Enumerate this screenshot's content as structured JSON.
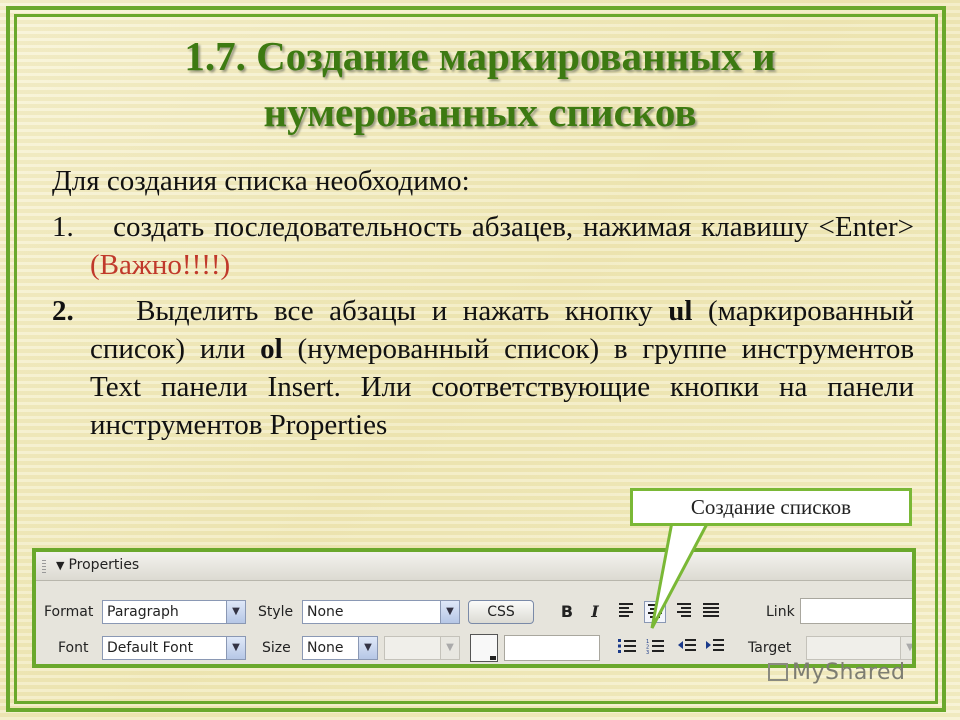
{
  "slide": {
    "title": "1.7. Создание маркированных и нумерованных списков",
    "intro": "Для создания списка необходимо:",
    "step1_num": "1.",
    "step1_text": "создать последовательность абзацев, нажимая клавишу <Enter>",
    "step1_note": "(Важно!!!!)",
    "step2_num": "2.",
    "step2_a": "Выделить все абзацы и нажать кнопку",
    "step2_ul": "ul",
    "step2_b": "(маркированный список) или",
    "step2_ol": "ol",
    "step2_c": "(нумерованный список) в группе инструментов Text панели Insert. Или соответствующие кнопки на панели инструментов Properties"
  },
  "callout": {
    "label": "Создание списков"
  },
  "properties_panel": {
    "title": "Properties",
    "format_label": "Format",
    "format_value": "Paragraph",
    "style_label": "Style",
    "style_value": "None",
    "css_button": "CSS",
    "bold": "B",
    "italic": "I",
    "link_label": "Link",
    "font_label": "Font",
    "font_value": "Default Font",
    "size_label": "Size",
    "size_value": "None",
    "target_label": "Target",
    "icons": [
      "bold-icon",
      "italic-icon",
      "align-left-icon",
      "align-center-icon",
      "align-right-icon",
      "justify-icon",
      "unordered-list-icon",
      "ordered-list-icon",
      "outdent-icon",
      "indent-icon"
    ]
  },
  "watermark": {
    "text": "MyShared"
  },
  "colors": {
    "frame": "#6aa82c",
    "title": "#3d7a12",
    "note": "#c0392b",
    "background": "#f4efc4"
  }
}
